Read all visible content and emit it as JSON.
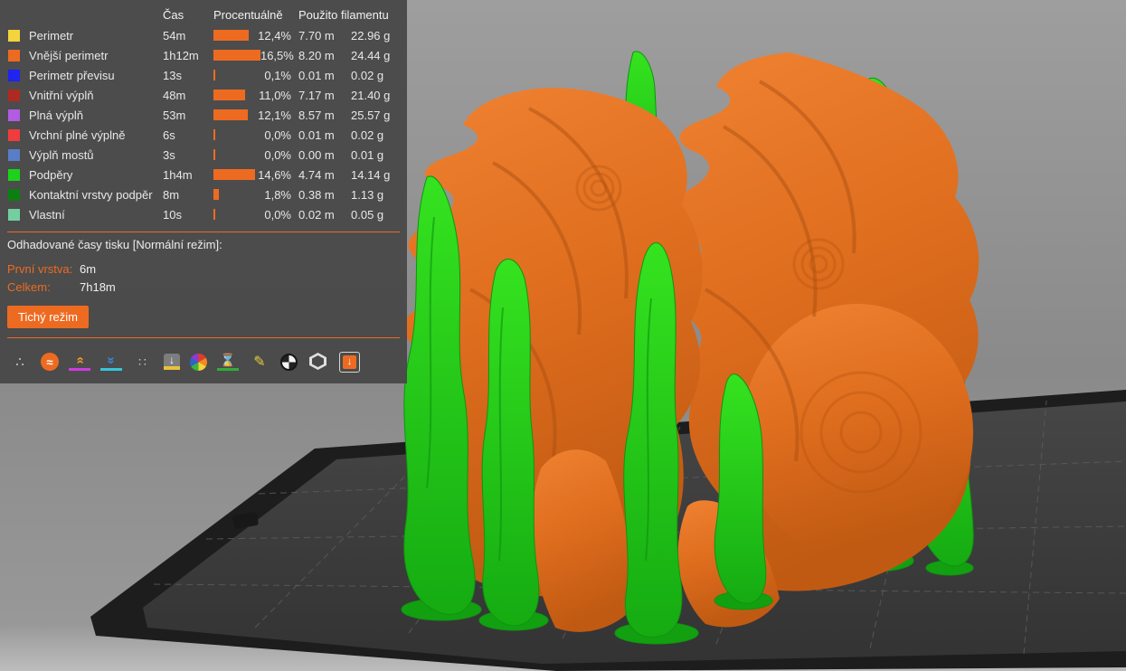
{
  "legend": {
    "columns": {
      "time": "Čas",
      "percentage": "Procentuálně",
      "filament": "Použito filamentu"
    },
    "bar_color": "#ED6B21",
    "rows": [
      {
        "label": "Perimetr",
        "color": "#F4D33C",
        "time": "54m",
        "percent": "12,4%",
        "percent_value": 12.4,
        "length": "7.70 m",
        "weight": "22.96 g"
      },
      {
        "label": "Vnější perimetr",
        "color": "#ED6B21",
        "time": "1h12m",
        "percent": "16,5%",
        "percent_value": 16.5,
        "length": "8.20 m",
        "weight": "24.44 g"
      },
      {
        "label": "Perimetr převisu",
        "color": "#1F24F0",
        "time": "13s",
        "percent": "0,1%",
        "percent_value": 0.1,
        "length": "0.01 m",
        "weight": "0.02 g"
      },
      {
        "label": "Vnitřní výplň",
        "color": "#AE2A20",
        "time": "48m",
        "percent": "11,0%",
        "percent_value": 11.0,
        "length": "7.17 m",
        "weight": "21.40 g"
      },
      {
        "label": "Plná výplň",
        "color": "#B15CE2",
        "time": "53m",
        "percent": "12,1%",
        "percent_value": 12.1,
        "length": "8.57 m",
        "weight": "25.57 g"
      },
      {
        "label": "Vrchní plné výplně",
        "color": "#F03C3C",
        "time": "6s",
        "percent": "0,0%",
        "percent_value": 0.0,
        "length": "0.01 m",
        "weight": "0.02 g"
      },
      {
        "label": "Výplň mostů",
        "color": "#5A7DC8",
        "time": "3s",
        "percent": "0,0%",
        "percent_value": 0.0,
        "length": "0.00 m",
        "weight": "0.01 g"
      },
      {
        "label": "Podpěry",
        "color": "#1CD21C",
        "time": "1h4m",
        "percent": "14,6%",
        "percent_value": 14.6,
        "length": "4.74 m",
        "weight": "14.14 g"
      },
      {
        "label": "Kontaktní vrstvy podpěr",
        "color": "#0C7F10",
        "time": "8m",
        "percent": "1,8%",
        "percent_value": 1.8,
        "length": "0.38 m",
        "weight": "1.13 g"
      },
      {
        "label": "Vlastní",
        "color": "#73CFA0",
        "time": "10s",
        "percent": "0,0%",
        "percent_value": 0.0,
        "length": "0.02 m",
        "weight": "0.05 g"
      }
    ],
    "estimates": {
      "title": "Odhadované časy tisku [Normální režim]:",
      "first_layer_label": "První vrstva:",
      "first_layer_value": "6m",
      "total_label": "Celkem:",
      "total_value": "7h18m",
      "mode_button_label": "Tichý režim"
    }
  },
  "toolbar": {
    "icons": [
      {
        "name": "travels",
        "glyph": "∴"
      },
      {
        "name": "wipe",
        "glyph": "≈"
      },
      {
        "name": "retractions",
        "glyph": "»"
      },
      {
        "name": "deretractions",
        "glyph": "»"
      },
      {
        "name": "seams",
        "glyph": "∷"
      },
      {
        "name": "tool-changes",
        "glyph": "↓"
      },
      {
        "name": "color-changes",
        "glyph": ""
      },
      {
        "name": "pause-prints",
        "glyph": "⌛"
      },
      {
        "name": "custom-gcodes",
        "glyph": "✎"
      },
      {
        "name": "center-of-gravity",
        "glyph": ""
      },
      {
        "name": "shells",
        "glyph": ""
      },
      {
        "name": "legend",
        "glyph": "↓"
      }
    ]
  },
  "scene": {
    "model_color": "#E0701F",
    "support_color": "#23CF1B",
    "support_interface_color": "#0C7F10",
    "bed_color": "#3A3A3A",
    "background_color": "#8E8E8E"
  }
}
